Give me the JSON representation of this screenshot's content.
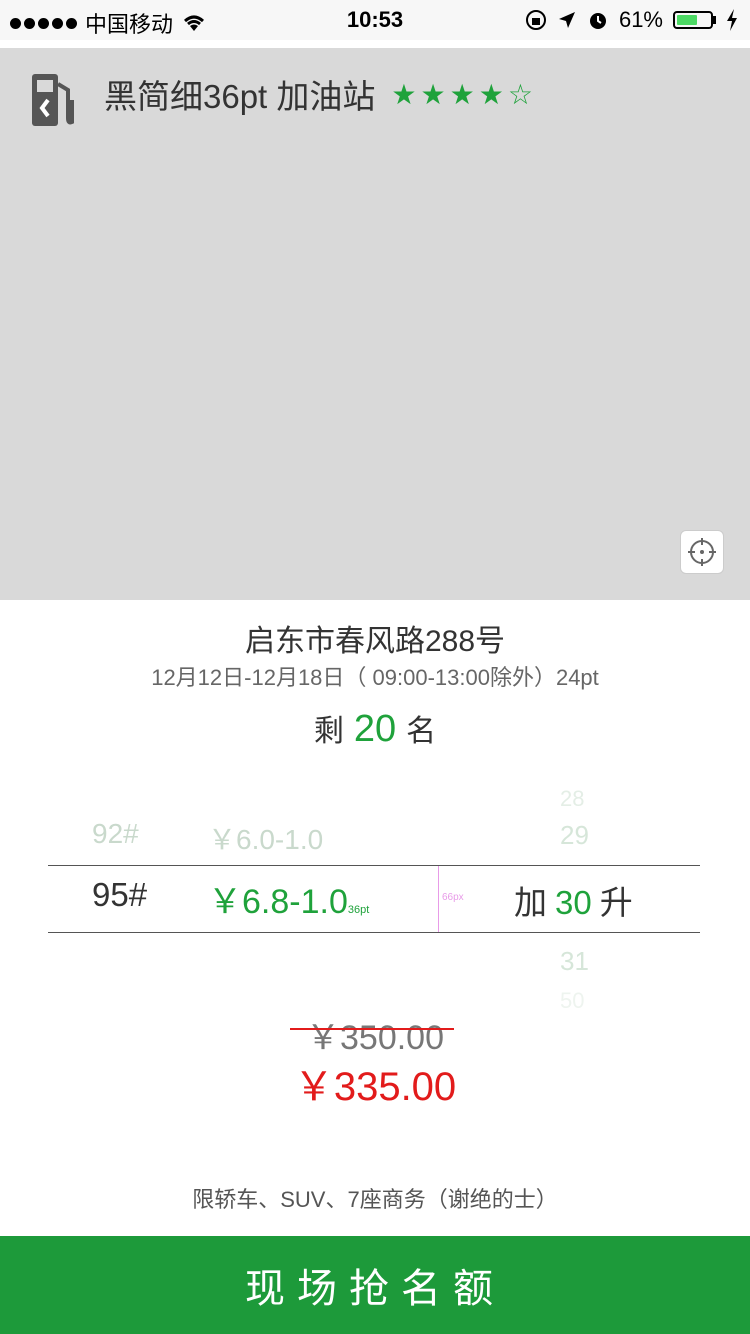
{
  "status_bar": {
    "carrier": "中国移动",
    "time": "10:53",
    "battery": "61%",
    "battery_level": 0.61
  },
  "station": {
    "title": "黑简细36pt 加油站",
    "stars": "★★★★☆"
  },
  "address": "启东市春风路288号",
  "date_range": "12月12日-12月18日（ 09:00-13:00除外）24pt",
  "remaining": {
    "prefix": "剩",
    "count": "20",
    "suffix": "名"
  },
  "picker": {
    "above": {
      "fuel": "92#",
      "price": "￥6.0-1.0"
    },
    "selected": {
      "fuel": "95#",
      "price": "￥6.8-1.0",
      "price_note": "36pt"
    },
    "guide_label": "66px",
    "quantity": {
      "prefix": "加",
      "value": "30",
      "suffix": "升"
    },
    "quantity_options": {
      "far_above": "28",
      "above": "29",
      "below": "31",
      "far_below": "50"
    }
  },
  "prices": {
    "original": "￥350.00",
    "discounted": "￥335.00"
  },
  "restriction": "限轿车、SUV、7座商务（谢绝的士）",
  "action_button": "现场抢名额",
  "colors": {
    "accent_green": "#1d9a3a",
    "price_red": "#e21b1b"
  }
}
